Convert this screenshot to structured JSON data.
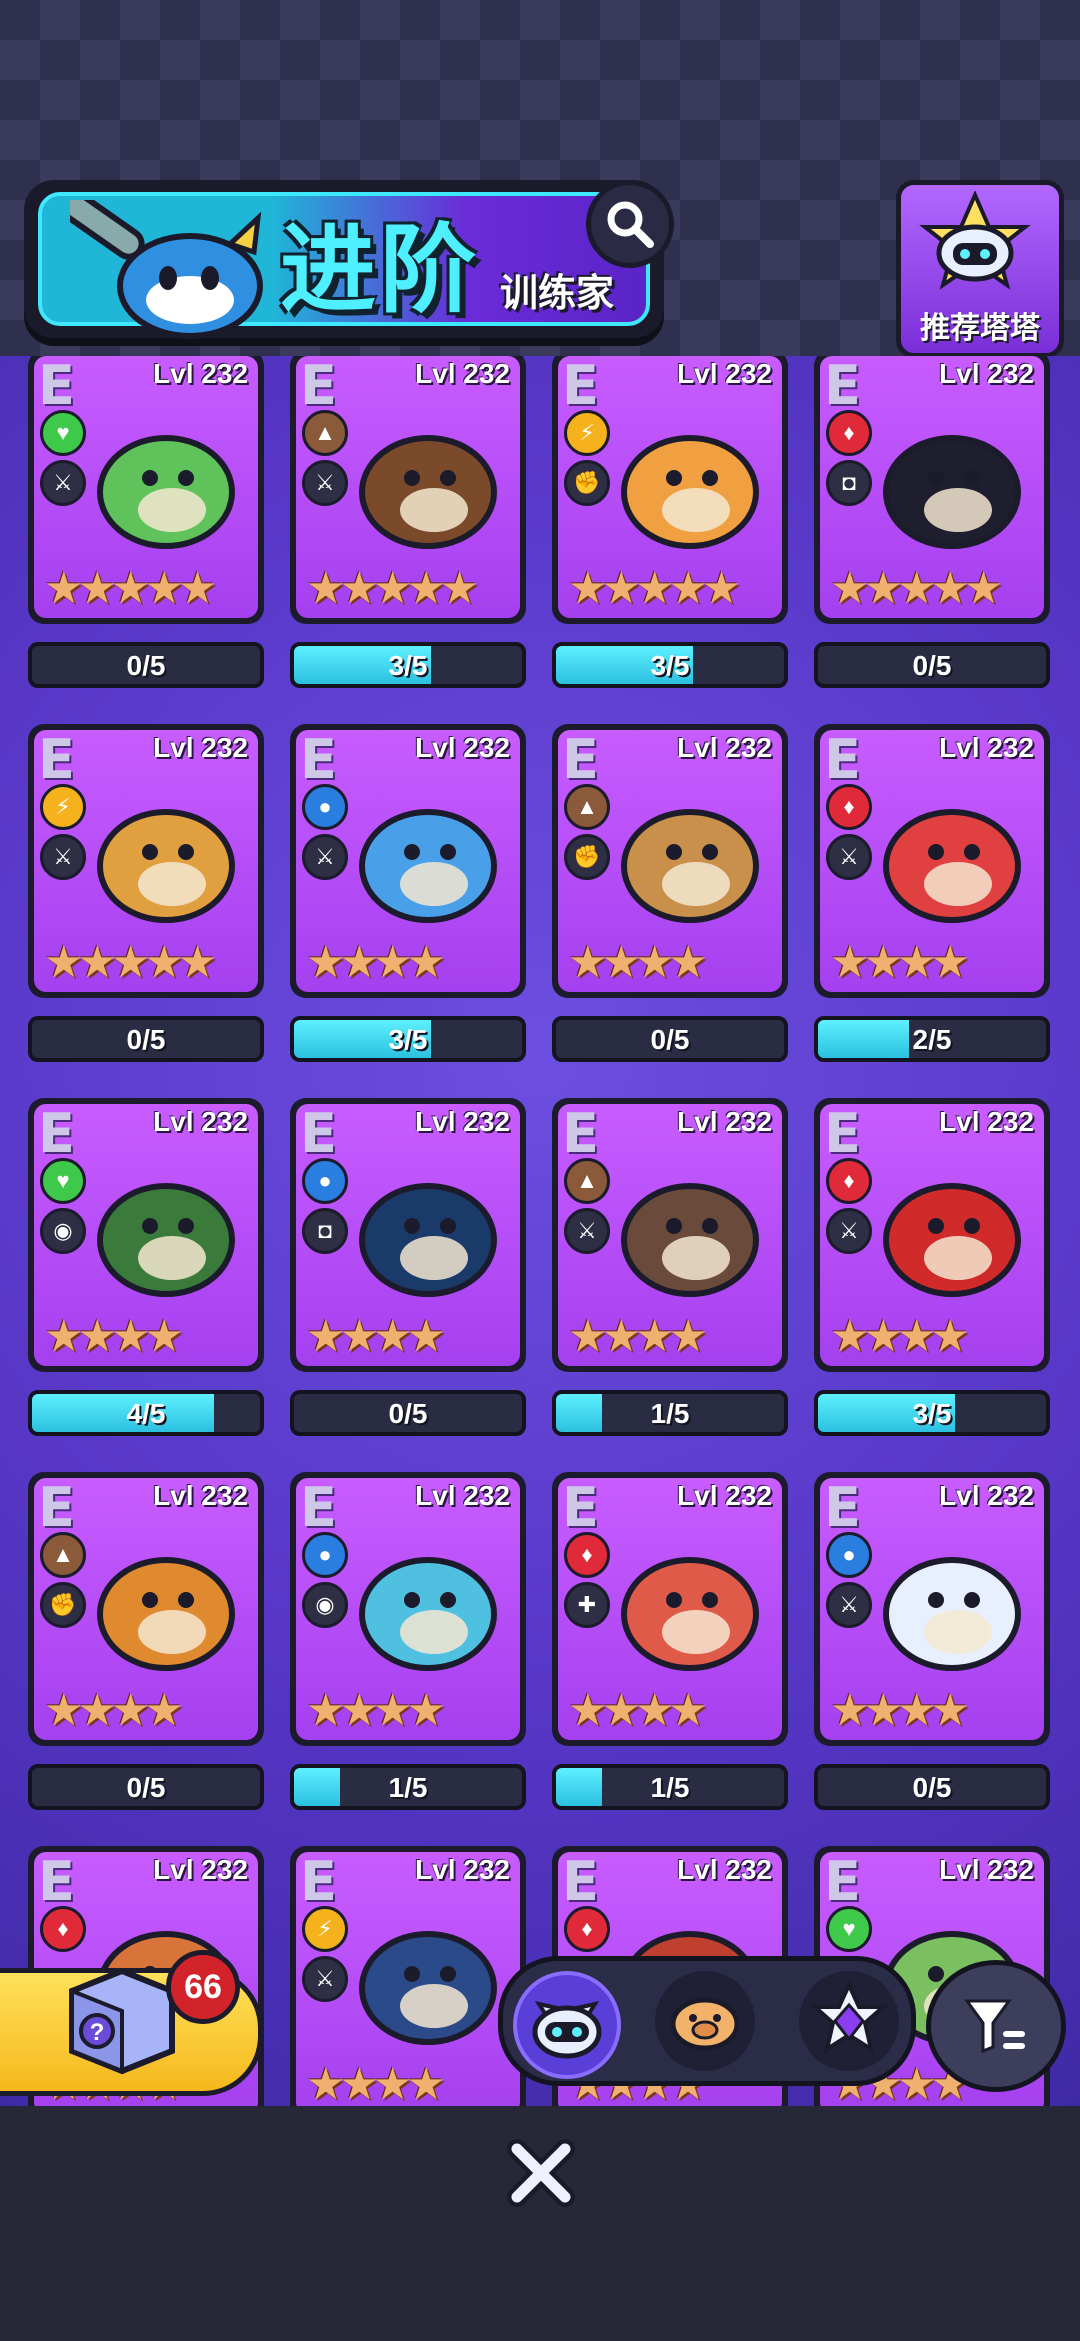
{
  "header": {
    "title": "进阶",
    "subtitle": "训练家",
    "search_icon": "search-icon",
    "recommend_label": "推荐塔塔"
  },
  "colors": {
    "accent_cyan": "#4ef0ff",
    "card_purple": "#b44cf8",
    "elem_grass": "#3ec94a",
    "elem_earth": "#8a5a3a",
    "elem_electric": "#f5b21c",
    "elem_fire": "#e02a3a",
    "elem_water": "#2a7ee0",
    "progress_fill": "#3ad6f0"
  },
  "cards": [
    {
      "rank": "E",
      "level": "Lvl 232",
      "element": "grass",
      "role": "sword-icon",
      "stars": 5,
      "progress": "0/5",
      "fill": 0
    },
    {
      "rank": "E",
      "level": "Lvl 232",
      "element": "earth",
      "role": "sword-icon",
      "stars": 5,
      "progress": "3/5",
      "fill": 0.6
    },
    {
      "rank": "E",
      "level": "Lvl 232",
      "element": "electric",
      "role": "fist-icon",
      "stars": 5,
      "progress": "3/5",
      "fill": 0.6
    },
    {
      "rank": "E",
      "level": "Lvl 232",
      "element": "fire",
      "role": "shield-icon",
      "stars": 5,
      "progress": "0/5",
      "fill": 0
    },
    {
      "rank": "E",
      "level": "Lvl 232",
      "element": "electric",
      "role": "sword-icon",
      "stars": 5,
      "progress": "0/5",
      "fill": 0
    },
    {
      "rank": "E",
      "level": "Lvl 232",
      "element": "water",
      "role": "sword-icon",
      "stars": 4,
      "progress": "3/5",
      "fill": 0.6
    },
    {
      "rank": "E",
      "level": "Lvl 232",
      "element": "earth",
      "role": "fist-icon",
      "stars": 4,
      "progress": "0/5",
      "fill": 0
    },
    {
      "rank": "E",
      "level": "Lvl 232",
      "element": "fire",
      "role": "sword-icon",
      "stars": 4,
      "progress": "2/5",
      "fill": 0.4
    },
    {
      "rank": "E",
      "level": "Lvl 232",
      "element": "grass",
      "role": "eye-icon",
      "stars": 4,
      "progress": "4/5",
      "fill": 0.8
    },
    {
      "rank": "E",
      "level": "Lvl 232",
      "element": "water",
      "role": "shield-icon",
      "stars": 4,
      "progress": "0/5",
      "fill": 0
    },
    {
      "rank": "E",
      "level": "Lvl 232",
      "element": "earth",
      "role": "sword-icon",
      "stars": 4,
      "progress": "1/5",
      "fill": 0.2
    },
    {
      "rank": "E",
      "level": "Lvl 232",
      "element": "fire",
      "role": "sword-icon",
      "stars": 4,
      "progress": "3/5",
      "fill": 0.6
    },
    {
      "rank": "E",
      "level": "Lvl 232",
      "element": "earth",
      "role": "fist-icon",
      "stars": 4,
      "progress": "0/5",
      "fill": 0
    },
    {
      "rank": "E",
      "level": "Lvl 232",
      "element": "water",
      "role": "eye-icon",
      "stars": 4,
      "progress": "1/5",
      "fill": 0.2
    },
    {
      "rank": "E",
      "level": "Lvl 232",
      "element": "fire",
      "role": "heal-icon",
      "stars": 4,
      "progress": "1/5",
      "fill": 0.2
    },
    {
      "rank": "E",
      "level": "Lvl 232",
      "element": "water",
      "role": "sword-icon",
      "stars": 4,
      "progress": "0/5",
      "fill": 0
    },
    {
      "rank": "E",
      "level": "Lvl 232",
      "element": "fire",
      "role": "",
      "stars": 4,
      "progress": "",
      "fill": 0
    },
    {
      "rank": "E",
      "level": "Lvl 232",
      "element": "electric",
      "role": "sword-icon",
      "stars": 4,
      "progress": "",
      "fill": 0
    },
    {
      "rank": "E",
      "level": "Lvl 232",
      "element": "fire",
      "role": "",
      "stars": 4,
      "progress": "",
      "fill": 0
    },
    {
      "rank": "E",
      "level": "Lvl 232",
      "element": "grass",
      "role": "",
      "stars": 4,
      "progress": "",
      "fill": 0
    }
  ],
  "bottom": {
    "mystery_box_count": "66",
    "tabs": [
      "cat-robot-icon",
      "pig-icon",
      "star-gem-icon"
    ],
    "filter_icon": "filter-icon",
    "close_icon": "close-icon"
  }
}
